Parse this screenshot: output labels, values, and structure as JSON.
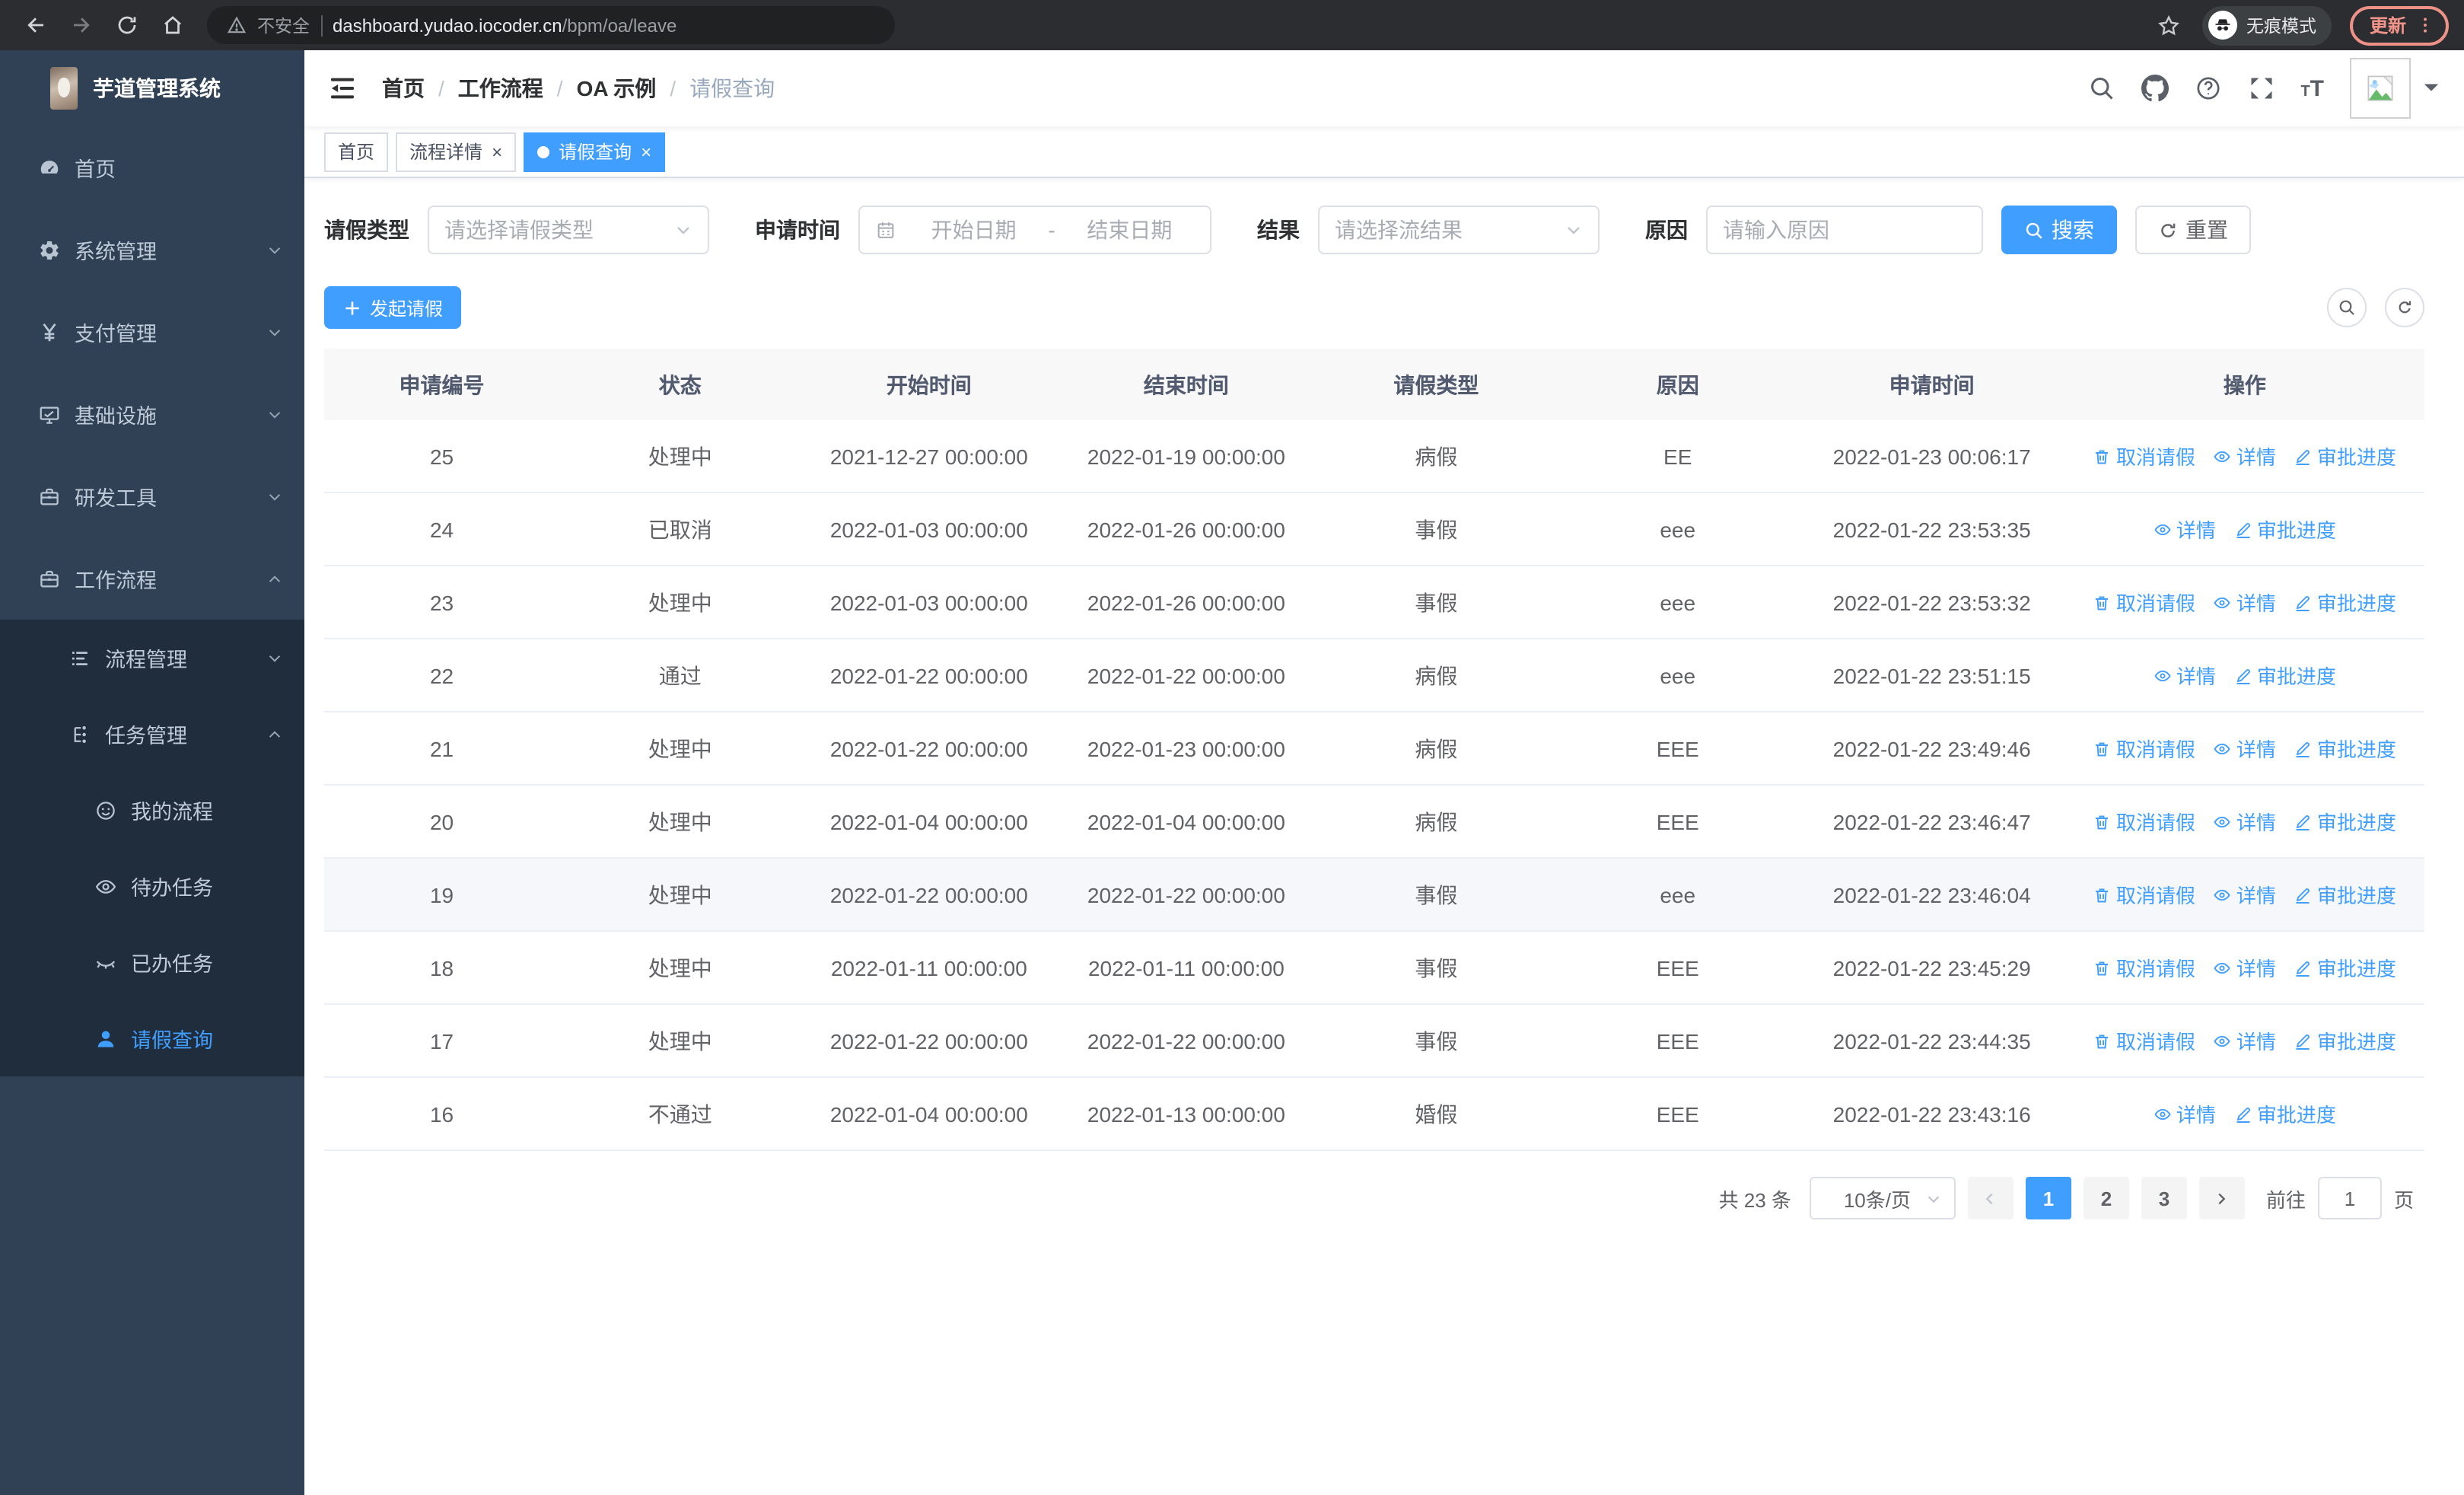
{
  "colors": {
    "primary": "#409eff",
    "sidebar_bg": "#304156",
    "submenu_bg": "#1f2d3d",
    "update_accent": "#f28b82"
  },
  "browser": {
    "security_label": "不安全",
    "url_host": "dashboard.yudao.iocoder.cn",
    "url_path": "/bpm/oa/leave",
    "incognito_label": "无痕模式",
    "update_label": "更新"
  },
  "sidebar": {
    "title": "芋道管理系统",
    "menu": [
      {
        "key": "home",
        "label": "首页",
        "icon": "dashboard-icon",
        "level": 0
      },
      {
        "key": "system",
        "label": "系统管理",
        "icon": "gear-icon",
        "level": 0,
        "chevron": "down"
      },
      {
        "key": "payment",
        "label": "支付管理",
        "icon": "yen-icon",
        "level": 0,
        "chevron": "down"
      },
      {
        "key": "infra",
        "label": "基础设施",
        "icon": "monitor-icon",
        "level": 0,
        "chevron": "down"
      },
      {
        "key": "devtools",
        "label": "研发工具",
        "icon": "briefcase-icon",
        "level": 0,
        "chevron": "down"
      },
      {
        "key": "workflow",
        "label": "工作流程",
        "icon": "briefcase-icon",
        "level": 0,
        "chevron": "up"
      },
      {
        "key": "process-mgmt",
        "label": "流程管理",
        "icon": "list-icon",
        "level": 1,
        "chevron": "down",
        "dark": true
      },
      {
        "key": "task-mgmt",
        "label": "任务管理",
        "icon": "tree-icon",
        "level": 1,
        "chevron": "up",
        "dark": true
      },
      {
        "key": "my-process",
        "label": "我的流程",
        "icon": "robot-icon",
        "level": 2,
        "dark": true
      },
      {
        "key": "todo-tasks",
        "label": "待办任务",
        "icon": "eye-icon",
        "level": 2,
        "dark": true
      },
      {
        "key": "done-tasks",
        "label": "已办任务",
        "icon": "eye-closed-icon",
        "level": 2,
        "dark": true
      },
      {
        "key": "leave-query",
        "label": "请假查询",
        "icon": "user-icon",
        "level": 2,
        "dark": true,
        "active": true
      }
    ]
  },
  "header": {
    "breadcrumb": [
      "首页",
      "工作流程",
      "OA 示例",
      "请假查询"
    ]
  },
  "tabs": [
    {
      "label": "首页",
      "closable": false,
      "active": false
    },
    {
      "label": "流程详情",
      "closable": true,
      "active": false
    },
    {
      "label": "请假查询",
      "closable": true,
      "active": true
    }
  ],
  "filters": {
    "leave_type_label": "请假类型",
    "leave_type_placeholder": "请选择请假类型",
    "apply_time_label": "申请时间",
    "date_start_placeholder": "开始日期",
    "date_separator": "-",
    "date_end_placeholder": "结束日期",
    "result_label": "结果",
    "result_placeholder": "请选择流结果",
    "reason_label": "原因",
    "reason_placeholder": "请输入原因",
    "search_label": "搜索",
    "reset_label": "重置"
  },
  "toolbar": {
    "create_label": "发起请假"
  },
  "table": {
    "columns": [
      "申请编号",
      "状态",
      "开始时间",
      "结束时间",
      "请假类型",
      "原因",
      "申请时间",
      "操作"
    ],
    "column_keys": [
      "id",
      "status",
      "start",
      "end",
      "type",
      "reason",
      "applied"
    ],
    "action_defs": {
      "cancel": {
        "label": "取消请假",
        "icon": "trash-icon"
      },
      "detail": {
        "label": "详情",
        "icon": "view-eye-icon"
      },
      "progress": {
        "label": "审批进度",
        "icon": "pen-icon"
      }
    },
    "rows": [
      {
        "id": "25",
        "status": "处理中",
        "start": "2021-12-27 00:00:00",
        "end": "2022-01-19 00:00:00",
        "type": "病假",
        "reason": "EE",
        "applied": "2022-01-23 00:06:17",
        "actions": [
          "cancel",
          "detail",
          "progress"
        ]
      },
      {
        "id": "24",
        "status": "已取消",
        "start": "2022-01-03 00:00:00",
        "end": "2022-01-26 00:00:00",
        "type": "事假",
        "reason": "eee",
        "applied": "2022-01-22 23:53:35",
        "actions": [
          "detail",
          "progress"
        ]
      },
      {
        "id": "23",
        "status": "处理中",
        "start": "2022-01-03 00:00:00",
        "end": "2022-01-26 00:00:00",
        "type": "事假",
        "reason": "eee",
        "applied": "2022-01-22 23:53:32",
        "actions": [
          "cancel",
          "detail",
          "progress"
        ]
      },
      {
        "id": "22",
        "status": "通过",
        "start": "2022-01-22 00:00:00",
        "end": "2022-01-22 00:00:00",
        "type": "病假",
        "reason": "eee",
        "applied": "2022-01-22 23:51:15",
        "actions": [
          "detail",
          "progress"
        ]
      },
      {
        "id": "21",
        "status": "处理中",
        "start": "2022-01-22 00:00:00",
        "end": "2022-01-23 00:00:00",
        "type": "病假",
        "reason": "EEE",
        "applied": "2022-01-22 23:49:46",
        "actions": [
          "cancel",
          "detail",
          "progress"
        ]
      },
      {
        "id": "20",
        "status": "处理中",
        "start": "2022-01-04 00:00:00",
        "end": "2022-01-04 00:00:00",
        "type": "病假",
        "reason": "EEE",
        "applied": "2022-01-22 23:46:47",
        "actions": [
          "cancel",
          "detail",
          "progress"
        ]
      },
      {
        "id": "19",
        "status": "处理中",
        "start": "2022-01-22 00:00:00",
        "end": "2022-01-22 00:00:00",
        "type": "事假",
        "reason": "eee",
        "applied": "2022-01-22 23:46:04",
        "actions": [
          "cancel",
          "detail",
          "progress"
        ],
        "highlight": true
      },
      {
        "id": "18",
        "status": "处理中",
        "start": "2022-01-11 00:00:00",
        "end": "2022-01-11 00:00:00",
        "type": "事假",
        "reason": "EEE",
        "applied": "2022-01-22 23:45:29",
        "actions": [
          "cancel",
          "detail",
          "progress"
        ]
      },
      {
        "id": "17",
        "status": "处理中",
        "start": "2022-01-22 00:00:00",
        "end": "2022-01-22 00:00:00",
        "type": "事假",
        "reason": "EEE",
        "applied": "2022-01-22 23:44:35",
        "actions": [
          "cancel",
          "detail",
          "progress"
        ]
      },
      {
        "id": "16",
        "status": "不通过",
        "start": "2022-01-04 00:00:00",
        "end": "2022-01-13 00:00:00",
        "type": "婚假",
        "reason": "EEE",
        "applied": "2022-01-22 23:43:16",
        "actions": [
          "detail",
          "progress"
        ]
      }
    ]
  },
  "pagination": {
    "total_label": "共 23 条",
    "page_size": "10条/页",
    "pages": [
      "1",
      "2",
      "3"
    ],
    "active_page": "1",
    "goto_label": "前往",
    "goto_value": "1",
    "page_suffix": "页"
  }
}
